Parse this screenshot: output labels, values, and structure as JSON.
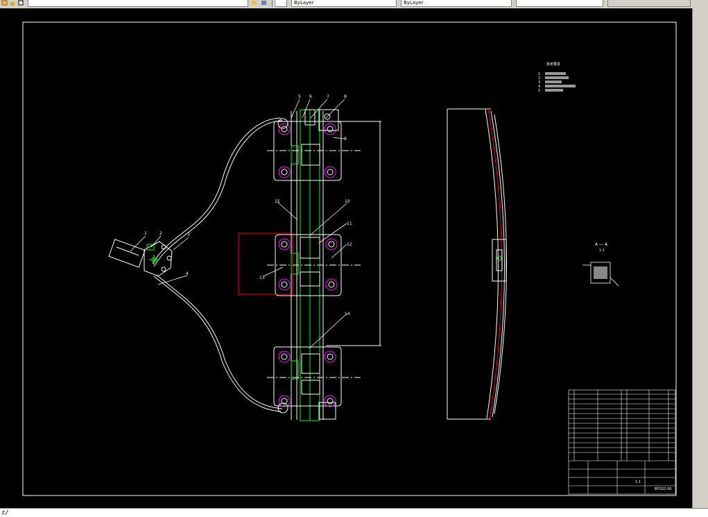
{
  "toolbar": {
    "layer_combo": "",
    "linetype_combo": "ByLayer",
    "lineweight_combo": "ByLayer",
    "plotstyle_combo": "",
    "color_combo": ""
  },
  "command_line": {
    "text": "z/"
  },
  "drawing": {
    "part_callouts": [
      "1",
      "2",
      "3",
      "4",
      "5",
      "6",
      "7",
      "8",
      "9",
      "10",
      "11",
      "12",
      "13",
      "14",
      "15"
    ],
    "section_label": "A — A",
    "section_scale": "1:1",
    "notes_title": "技术要求",
    "notes": [
      "1",
      "2",
      "3",
      "4",
      "5"
    ],
    "title_block": {
      "drawing_no": "BYGS2-00",
      "scale": "1:1"
    }
  },
  "colors": {
    "background": "#000000",
    "line": "#ffffff",
    "green": "#00ff00",
    "magenta": "#ff00ff",
    "red": "#ff0000",
    "chrome": "#d4d0c8"
  }
}
